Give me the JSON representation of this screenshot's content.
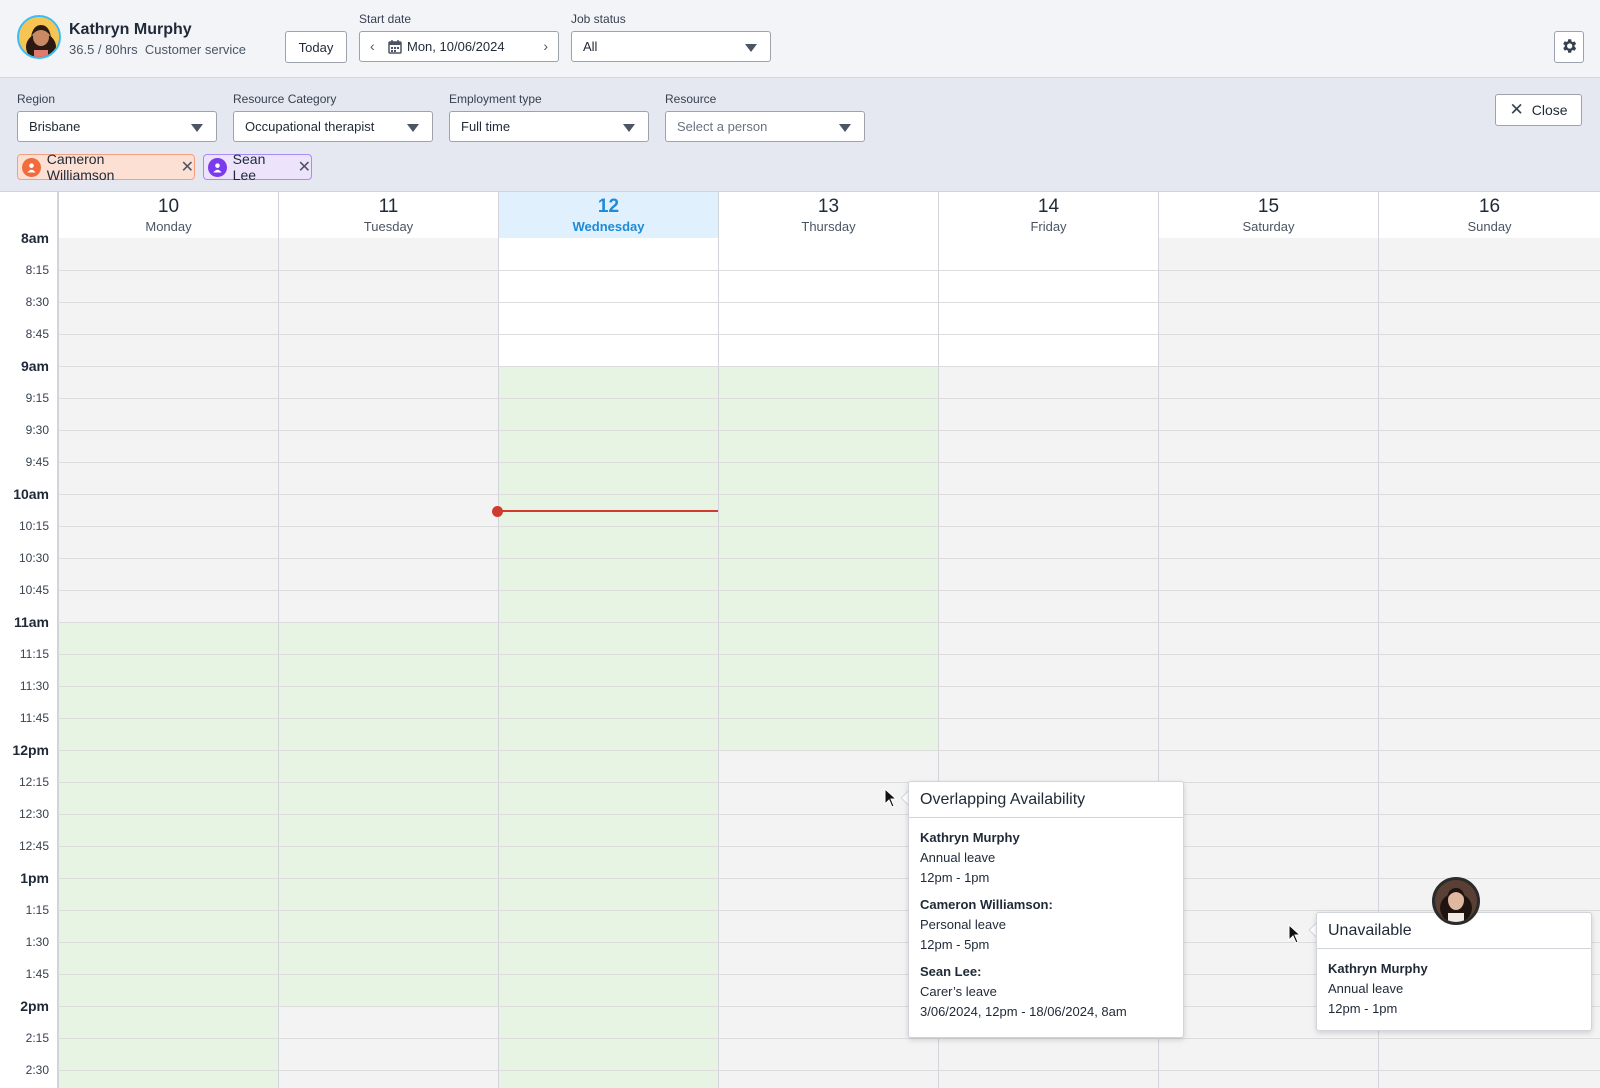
{
  "header": {
    "user_name": "Kathryn Murphy",
    "user_hours": "36.5 / 80hrs",
    "user_role": "Customer service",
    "today_label": "Today",
    "start_date_label": "Start date",
    "start_date_value": "Mon, 10/06/2024",
    "job_status_label": "Job status",
    "job_status_value": "All"
  },
  "filters": {
    "region_label": "Region",
    "region_value": "Brisbane",
    "resource_category_label": "Resource Category",
    "resource_category_value": "Occupational therapist",
    "employment_type_label": "Employment type",
    "employment_type_value": "Full time",
    "resource_label": "Resource",
    "resource_placeholder": "Select a person",
    "close_label": "Close",
    "chips": [
      {
        "name": "Cameron Williamson",
        "color": "#f26b3a",
        "bg": "#fde0d4",
        "border": "#f59e80"
      },
      {
        "name": "Sean Lee",
        "color": "#7c3aed",
        "bg": "#ede4fb",
        "border": "#a78bfa"
      }
    ]
  },
  "calendar": {
    "days": [
      {
        "num": "10",
        "name": "Monday"
      },
      {
        "num": "11",
        "name": "Tuesday"
      },
      {
        "num": "12",
        "name": "Wednesday",
        "today": true
      },
      {
        "num": "13",
        "name": "Thursday"
      },
      {
        "num": "14",
        "name": "Friday"
      },
      {
        "num": "15",
        "name": "Saturday"
      },
      {
        "num": "16",
        "name": "Sunday"
      }
    ],
    "times": [
      "8am",
      "8:15",
      "8:30",
      "8:45",
      "9am",
      "9:15",
      "9:30",
      "9:45",
      "10am",
      "10:15",
      "10:30",
      "10:45",
      "11am",
      "11:15",
      "11:30",
      "11:45",
      "12pm",
      "12:15",
      "12:30",
      "12:45",
      "1pm",
      "1:15",
      "1:30",
      "1:45",
      "2pm",
      "2:15",
      "2:30"
    ],
    "colors": {
      "green": "#e8f4e3",
      "now": "#d13b2f",
      "today": "#1d8bd8"
    }
  },
  "popover_overlap": {
    "title": "Overlapping Availability",
    "entries": [
      {
        "name": "Kathryn Murphy",
        "type": "Annual leave",
        "time": "12pm - 1pm"
      },
      {
        "name": "Cameron Williamson:",
        "type": "Personal leave",
        "time": "12pm -  5pm"
      },
      {
        "name": "Sean Lee:",
        "type": "Carer’s leave",
        "time": "3/06/2024, 12pm - 18/06/2024, 8am"
      }
    ]
  },
  "popover_unavailable": {
    "title": "Unavailable",
    "entries": [
      {
        "name": "Kathryn Murphy",
        "type": "Annual leave",
        "time": "12pm - 1pm"
      }
    ]
  }
}
